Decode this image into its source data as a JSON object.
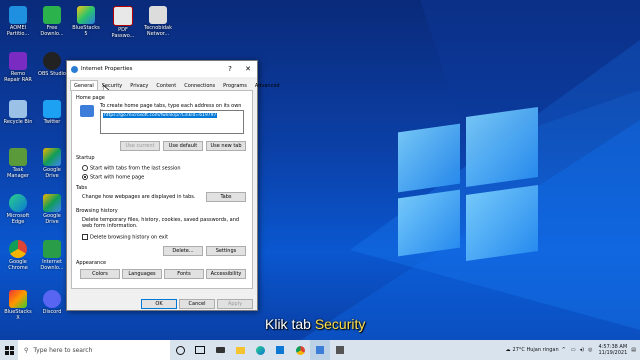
{
  "desktop": {
    "icons": [
      {
        "label": "AOMEI Partitio..."
      },
      {
        "label": "Free Downlo..."
      },
      {
        "label": "BlueStacks 5"
      },
      {
        "label": "PDF Passwo..."
      },
      {
        "label": "Tecnobidak Networ..."
      },
      {
        "label": "Remo Repair RAR"
      },
      {
        "label": "OBS Studio"
      },
      {
        "label": "Recycle Bin"
      },
      {
        "label": "Twitter"
      },
      {
        "label": "Task Manager"
      },
      {
        "label": "Google Drive"
      },
      {
        "label": "Microsoft Edge"
      },
      {
        "label": "Google Drive"
      },
      {
        "label": "Google Chrome"
      },
      {
        "label": "Internet Downlo..."
      },
      {
        "label": "BlueStacks X"
      },
      {
        "label": "Discord"
      }
    ]
  },
  "dialog": {
    "title": "Internet Properties",
    "help": "?",
    "close": "✕",
    "tabs": [
      "General",
      "Security",
      "Privacy",
      "Content",
      "Connections",
      "Programs",
      "Advanced"
    ],
    "home": {
      "heading": "Home page",
      "desc": "To create home page tabs, type each address on its own line.",
      "url": "https://go.microsoft.com/fwlink/p/?LinkId=619797",
      "use_current": "Use current",
      "use_default": "Use default",
      "use_new_tab": "Use new tab"
    },
    "startup": {
      "heading": "Startup",
      "opt1": "Start with tabs from the last session",
      "opt2": "Start with home page"
    },
    "tabs_sec": {
      "heading": "Tabs",
      "desc": "Change how webpages are displayed in tabs.",
      "btn": "Tabs"
    },
    "history": {
      "heading": "Browsing history",
      "desc": "Delete temporary files, history, cookies, saved passwords, and web form information.",
      "checkbox": "Delete browsing history on exit",
      "delete": "Delete...",
      "settings": "Settings"
    },
    "appearance": {
      "heading": "Appearance",
      "colors": "Colors",
      "languages": "Languages",
      "fonts": "Fonts",
      "accessibility": "Accessibility"
    },
    "ok": "OK",
    "cancel": "Cancel",
    "apply": "Apply"
  },
  "subtitle": {
    "prefix": "Klik tab",
    "highlight": "Security"
  },
  "taskbar": {
    "search_placeholder": "Type here to search",
    "weather": "27°C  Hujan ringan",
    "time": "4:57:38 AM",
    "date": "11/19/2021"
  },
  "colors": {
    "accent": "#0078d7",
    "highlight": "#ffe24a"
  }
}
